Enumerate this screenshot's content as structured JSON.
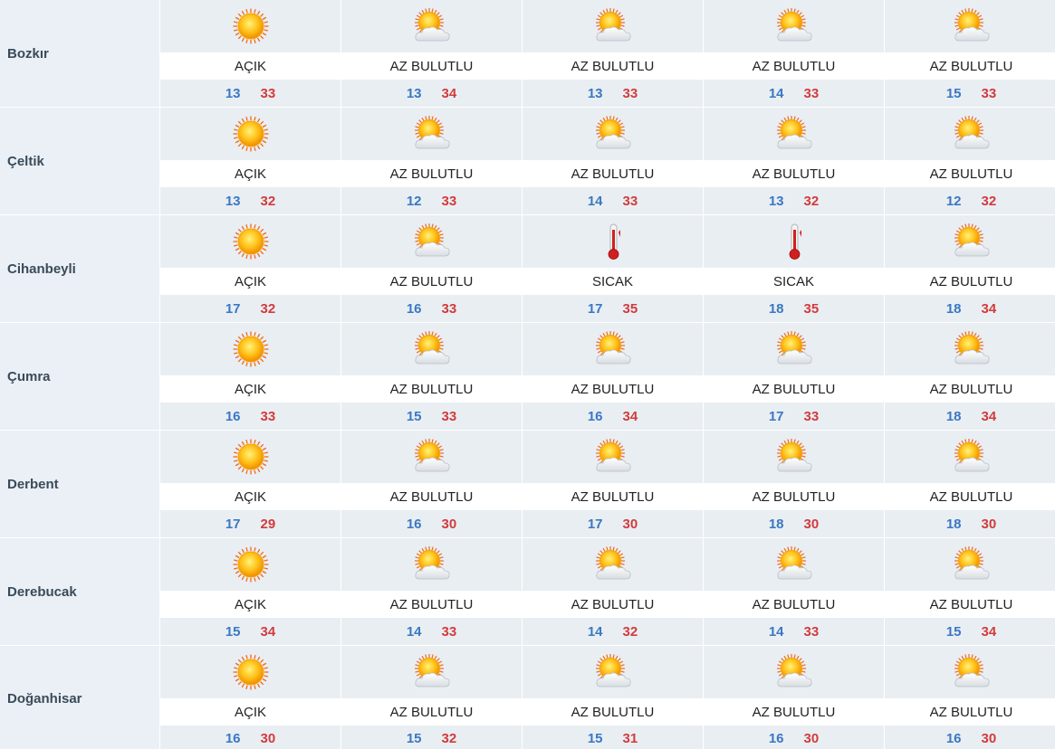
{
  "rows": [
    {
      "city": "Bozkır",
      "days": [
        {
          "icon": "sun-icon",
          "desc": "AÇIK",
          "min": "13",
          "max": "33"
        },
        {
          "icon": "partly-cloudy-icon",
          "desc": "AZ BULUTLU",
          "min": "13",
          "max": "34"
        },
        {
          "icon": "partly-cloudy-icon",
          "desc": "AZ BULUTLU",
          "min": "13",
          "max": "33"
        },
        {
          "icon": "partly-cloudy-icon",
          "desc": "AZ BULUTLU",
          "min": "14",
          "max": "33"
        },
        {
          "icon": "partly-cloudy-icon",
          "desc": "AZ BULUTLU",
          "min": "15",
          "max": "33"
        }
      ]
    },
    {
      "city": "Çeltik",
      "days": [
        {
          "icon": "sun-icon",
          "desc": "AÇIK",
          "min": "13",
          "max": "32"
        },
        {
          "icon": "partly-cloudy-icon",
          "desc": "AZ BULUTLU",
          "min": "12",
          "max": "33"
        },
        {
          "icon": "partly-cloudy-icon",
          "desc": "AZ BULUTLU",
          "min": "14",
          "max": "33"
        },
        {
          "icon": "partly-cloudy-icon",
          "desc": "AZ BULUTLU",
          "min": "13",
          "max": "32"
        },
        {
          "icon": "partly-cloudy-icon",
          "desc": "AZ BULUTLU",
          "min": "12",
          "max": "32"
        }
      ]
    },
    {
      "city": "Cihanbeyli",
      "days": [
        {
          "icon": "sun-icon",
          "desc": "AÇIK",
          "min": "17",
          "max": "32"
        },
        {
          "icon": "partly-cloudy-icon",
          "desc": "AZ BULUTLU",
          "min": "16",
          "max": "33"
        },
        {
          "icon": "thermometer-icon",
          "desc": "SICAK",
          "min": "17",
          "max": "35"
        },
        {
          "icon": "thermometer-icon",
          "desc": "SICAK",
          "min": "18",
          "max": "35"
        },
        {
          "icon": "partly-cloudy-icon",
          "desc": "AZ BULUTLU",
          "min": "18",
          "max": "34"
        }
      ]
    },
    {
      "city": "Çumra",
      "days": [
        {
          "icon": "sun-icon",
          "desc": "AÇIK",
          "min": "16",
          "max": "33"
        },
        {
          "icon": "partly-cloudy-icon",
          "desc": "AZ BULUTLU",
          "min": "15",
          "max": "33"
        },
        {
          "icon": "partly-cloudy-icon",
          "desc": "AZ BULUTLU",
          "min": "16",
          "max": "34"
        },
        {
          "icon": "partly-cloudy-icon",
          "desc": "AZ BULUTLU",
          "min": "17",
          "max": "33"
        },
        {
          "icon": "partly-cloudy-icon",
          "desc": "AZ BULUTLU",
          "min": "18",
          "max": "34"
        }
      ]
    },
    {
      "city": "Derbent",
      "days": [
        {
          "icon": "sun-icon",
          "desc": "AÇIK",
          "min": "17",
          "max": "29"
        },
        {
          "icon": "partly-cloudy-icon",
          "desc": "AZ BULUTLU",
          "min": "16",
          "max": "30"
        },
        {
          "icon": "partly-cloudy-icon",
          "desc": "AZ BULUTLU",
          "min": "17",
          "max": "30"
        },
        {
          "icon": "partly-cloudy-icon",
          "desc": "AZ BULUTLU",
          "min": "18",
          "max": "30"
        },
        {
          "icon": "partly-cloudy-icon",
          "desc": "AZ BULUTLU",
          "min": "18",
          "max": "30"
        }
      ]
    },
    {
      "city": "Derebucak",
      "days": [
        {
          "icon": "sun-icon",
          "desc": "AÇIK",
          "min": "15",
          "max": "34"
        },
        {
          "icon": "partly-cloudy-icon",
          "desc": "AZ BULUTLU",
          "min": "14",
          "max": "33"
        },
        {
          "icon": "partly-cloudy-icon",
          "desc": "AZ BULUTLU",
          "min": "14",
          "max": "32"
        },
        {
          "icon": "partly-cloudy-icon",
          "desc": "AZ BULUTLU",
          "min": "14",
          "max": "33"
        },
        {
          "icon": "partly-cloudy-icon",
          "desc": "AZ BULUTLU",
          "min": "15",
          "max": "34"
        }
      ]
    },
    {
      "city": "Doğanhisar",
      "days": [
        {
          "icon": "sun-icon",
          "desc": "AÇIK",
          "min": "16",
          "max": "30"
        },
        {
          "icon": "partly-cloudy-icon",
          "desc": "AZ BULUTLU",
          "min": "15",
          "max": "32"
        },
        {
          "icon": "partly-cloudy-icon",
          "desc": "AZ BULUTLU",
          "min": "15",
          "max": "31"
        },
        {
          "icon": "partly-cloudy-icon",
          "desc": "AZ BULUTLU",
          "min": "16",
          "max": "30"
        },
        {
          "icon": "partly-cloudy-icon",
          "desc": "AZ BULUTLU",
          "min": "16",
          "max": "30"
        }
      ]
    }
  ],
  "colors": {
    "min_temp": "#3a78c2",
    "max_temp": "#d23b3b",
    "cell_bg": "#e9eef3",
    "city_text": "#3a4a5a"
  }
}
